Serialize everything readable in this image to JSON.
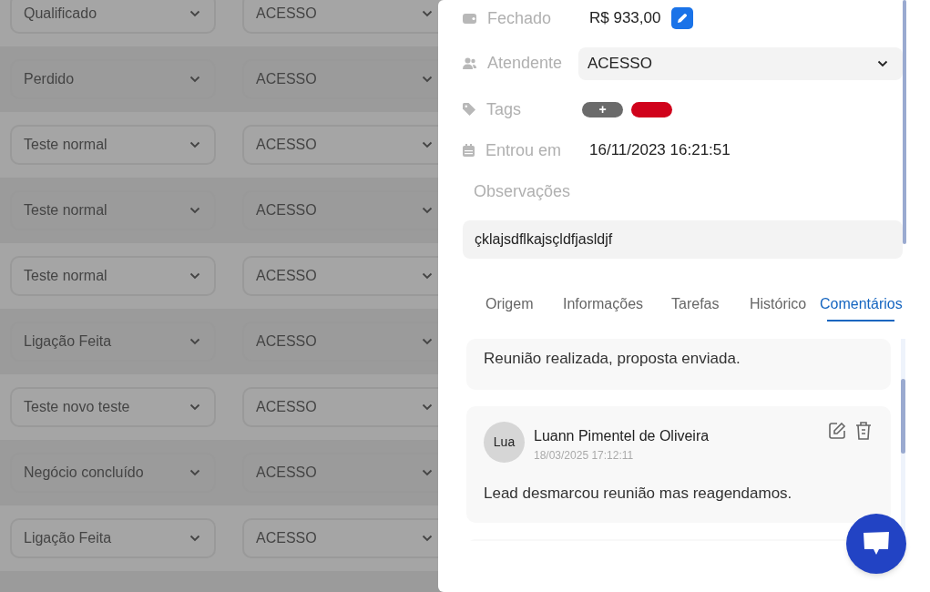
{
  "leads": [
    {
      "stage": "Qualificado",
      "owner": "ACESSO"
    },
    {
      "stage": "Perdido",
      "owner": "ACESSO"
    },
    {
      "stage": "Teste normal",
      "owner": "ACESSO"
    },
    {
      "stage": "Teste normal",
      "owner": "ACESSO"
    },
    {
      "stage": "Teste normal",
      "owner": "ACESSO"
    },
    {
      "stage": "Ligação Feita",
      "owner": "ACESSO"
    },
    {
      "stage": "Teste novo teste",
      "owner": "ACESSO"
    },
    {
      "stage": "Negócio concluído",
      "owner": "ACESSO"
    },
    {
      "stage": "Ligação Feita",
      "owner": "ACESSO"
    }
  ],
  "details": {
    "closed": {
      "label": "Fechado",
      "value": "R$ 933,00"
    },
    "attendant": {
      "label": "Atendente",
      "value": "ACESSO"
    },
    "tags": {
      "label": "Tags",
      "items": [
        {
          "kind": "add",
          "label": "+"
        },
        {
          "kind": "tag",
          "color": "#d0021b"
        }
      ]
    },
    "entered": {
      "label": "Entrou em",
      "value": "16/11/2023 16:21:51"
    },
    "notes": {
      "label": "Observações",
      "value": "çklajsdflkajsçldfjasldjf"
    }
  },
  "tabs": [
    {
      "label": "Origem",
      "selected": false
    },
    {
      "label": "Informações",
      "selected": false
    },
    {
      "label": "Tarefas",
      "selected": false
    },
    {
      "label": "Histórico",
      "selected": false
    },
    {
      "label": "Comentários",
      "selected": true
    }
  ],
  "comments": [
    {
      "text": "Reunião realizada, proposta enviada."
    },
    {
      "avatar": "Lua",
      "author": "Luann Pimentel de Oliveira",
      "date": "18/03/2025 17:12:11",
      "text": "Lead desmarcou reunião mas reagendamos."
    }
  ]
}
